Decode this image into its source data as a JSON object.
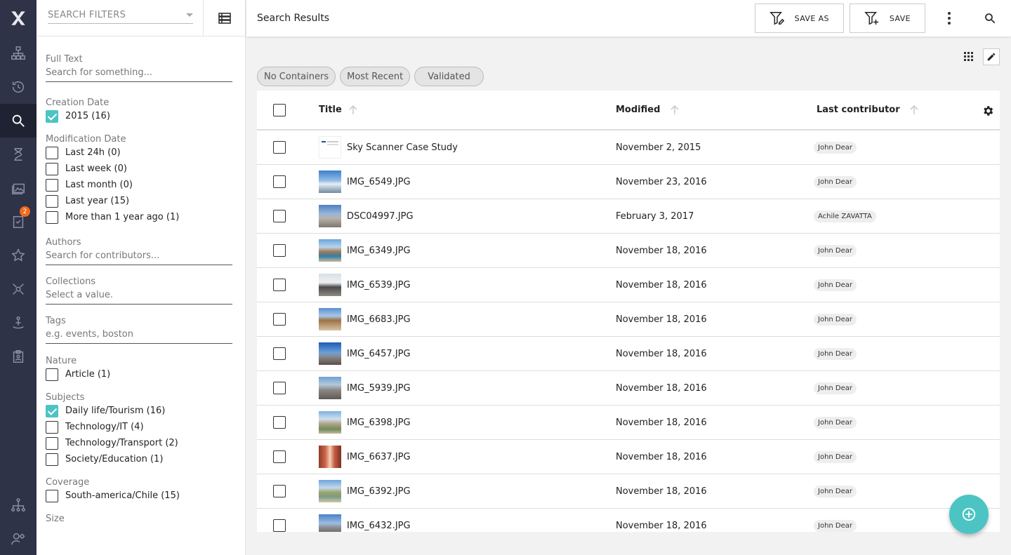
{
  "colors": {
    "rail": "#2f3347",
    "accent": "#4cc4c4",
    "badge": "#f26a1b"
  },
  "rail": {
    "items": [
      "browse-icon",
      "history-icon",
      "search-icon",
      "hourglass-icon",
      "gallery-icon",
      "tasks-icon",
      "favorites-icon",
      "collaboration-icon",
      "anchor-icon",
      "clipboard-icon"
    ],
    "bottom": [
      "sitemap-icon",
      "user-settings-icon"
    ],
    "tasks_badge": "2"
  },
  "filters": {
    "select_placeholder": "SEARCH FILTERS",
    "full_text": {
      "label": "Full Text",
      "placeholder": "Search for something..."
    },
    "creation_date": {
      "label": "Creation Date",
      "options": [
        {
          "label": "2015 (16)",
          "checked": true
        }
      ]
    },
    "modification_date": {
      "label": "Modification Date",
      "options": [
        {
          "label": "Last 24h (0)",
          "checked": false
        },
        {
          "label": "Last week (0)",
          "checked": false
        },
        {
          "label": "Last month (0)",
          "checked": false
        },
        {
          "label": "Last year (15)",
          "checked": false
        },
        {
          "label": "More than 1 year ago (1)",
          "checked": false
        }
      ]
    },
    "authors": {
      "label": "Authors",
      "placeholder": "Search for contributors..."
    },
    "collections": {
      "label": "Collections",
      "placeholder": "Select a value."
    },
    "tags": {
      "label": "Tags",
      "placeholder": "e.g. events, boston"
    },
    "nature": {
      "label": "Nature",
      "options": [
        {
          "label": "Article (1)",
          "checked": false
        }
      ]
    },
    "subjects": {
      "label": "Subjects",
      "options": [
        {
          "label": "Daily life/Tourism (16)",
          "checked": true
        },
        {
          "label": "Technology/IT (4)",
          "checked": false
        },
        {
          "label": "Technology/Transport (2)",
          "checked": false
        },
        {
          "label": "Society/Education (1)",
          "checked": false
        }
      ]
    },
    "coverage": {
      "label": "Coverage",
      "options": [
        {
          "label": "South-america/Chile (15)",
          "checked": false
        }
      ]
    },
    "size": {
      "label": "Size"
    }
  },
  "topbar": {
    "title": "Search Results",
    "save_as": "SAVE AS",
    "save": "SAVE"
  },
  "chips": [
    "No Containers",
    "Most Recent",
    "Validated"
  ],
  "table": {
    "headers": {
      "title": "Title",
      "modified": "Modified",
      "contributor": "Last contributor"
    },
    "rows": [
      {
        "title": "Sky Scanner Case Study",
        "modified": "November 2, 2015",
        "contributor": "John Dear",
        "thumb": "doc"
      },
      {
        "title": "IMG_6549.JPG",
        "modified": "November 23, 2016",
        "contributor": "John Dear",
        "thumb": "linear-gradient(180deg,#3f7fc9 0%,#8fbde8 45%,#e8eef2 60%,#6e8aa0 100%)"
      },
      {
        "title": "DSC04997.JPG",
        "modified": "February 3, 2017",
        "contributor": "Achile ZAVATTA",
        "thumb": "linear-gradient(180deg,#4d7fc4 0%,#9ab5d9 40%,#b8b2ab 60%,#7b7670 100%)"
      },
      {
        "title": "IMG_6349.JPG",
        "modified": "November 18, 2016",
        "contributor": "John Dear",
        "thumb": "linear-gradient(180deg,#6aa4df 0%,#b9d3ea 35%,#a27a55 55%,#2f7fa8 75%,#c9b79a 100%)"
      },
      {
        "title": "IMG_6539.JPG",
        "modified": "November 18, 2016",
        "contributor": "John Dear",
        "thumb": "linear-gradient(180deg,#d8dfe6 0%,#eef1f3 40%,#4a4a4a 60%,#8f8a80 100%)"
      },
      {
        "title": "IMG_6683.JPG",
        "modified": "November 18, 2016",
        "contributor": "John Dear",
        "thumb": "linear-gradient(180deg,#5a8fd0 0%,#a7c7e6 35%,#9a7247 55%,#d8c3a1 100%)"
      },
      {
        "title": "IMG_6457.JPG",
        "modified": "November 18, 2016",
        "contributor": "John Dear",
        "thumb": "linear-gradient(180deg,#1f5bb3 0%,#6b9edb 45%,#8a8f99 60%,#5d4e44 100%)"
      },
      {
        "title": "IMG_5939.JPG",
        "modified": "November 18, 2016",
        "contributor": "John Dear",
        "thumb": "linear-gradient(180deg,#6e9fd6 0%,#b3c8dc 35%,#8a8582 60%,#5f5a55 100%)"
      },
      {
        "title": "IMG_6398.JPG",
        "modified": "November 18, 2016",
        "contributor": "John Dear",
        "thumb": "linear-gradient(180deg,#7eb0e3 0%,#cfe0ee 35%,#b5a68a 55%,#6f8a5d 80%,#c4b898 100%)"
      },
      {
        "title": "IMG_6637.JPG",
        "modified": "November 18, 2016",
        "contributor": "John Dear",
        "thumb": "linear-gradient(90deg,#8e3b2a 0%,#d0654a 30%,#f1d0b8 50%,#c75b43 70%,#7a3123 100%)"
      },
      {
        "title": "IMG_6392.JPG",
        "modified": "November 18, 2016",
        "contributor": "John Dear",
        "thumb": "linear-gradient(180deg,#6ea3dc 0%,#c2d8ec 35%,#9aa56b 55%,#7a9a8a 75%,#d2c6a4 100%)"
      },
      {
        "title": "IMG_6432.JPG",
        "modified": "November 18, 2016",
        "contributor": "John Dear",
        "thumb": "linear-gradient(180deg,#4a80c8 0%,#9bbde0 40%,#8c8c90 60%,#504a45 100%)"
      }
    ]
  }
}
